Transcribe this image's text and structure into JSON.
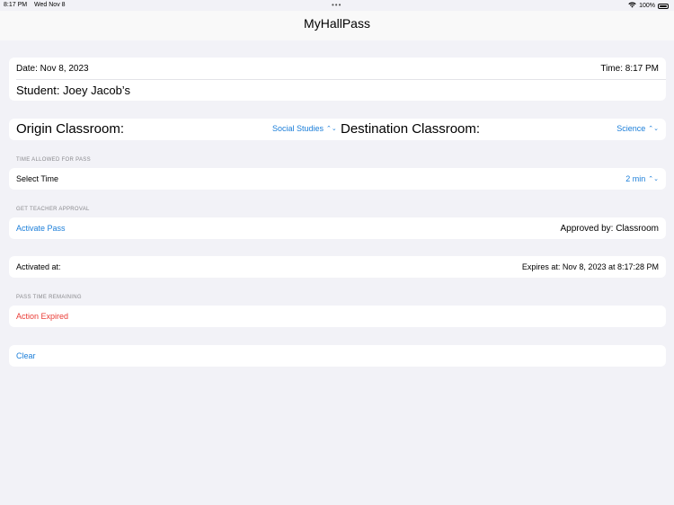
{
  "status": {
    "time": "8:17 PM",
    "date": "Wed Nov 8",
    "battery": "100%"
  },
  "app": {
    "title": "MyHallPass"
  },
  "info": {
    "date_label": "Date: Nov 8, 2023",
    "time_label": "Time: 8:17 PM",
    "student_label": "Student: Joey Jacob’s"
  },
  "classrooms": {
    "origin_label": "Origin Classroom:",
    "origin_value": "Social Studies",
    "destination_label": "Destination Classroom:",
    "destination_value": "Science"
  },
  "time_section": {
    "header": "TIME ALLOWED FOR PASS",
    "label": "Select Time",
    "value": "2 min"
  },
  "approval_section": {
    "header": "GET TEACHER APPROVAL",
    "activate": "Activate Pass",
    "approved_by": "Approved by: Classroom"
  },
  "activation": {
    "activated": "Activated at:",
    "expires": "Expires at: Nov 8, 2023 at 8:17:28 PM"
  },
  "remaining_section": {
    "header": "PASS TIME REMAINING",
    "status": "Action Expired"
  },
  "actions": {
    "clear": "Clear"
  },
  "colors": {
    "accent": "#1b7ed9",
    "danger": "#ea3b35",
    "background": "#f2f2f7"
  }
}
